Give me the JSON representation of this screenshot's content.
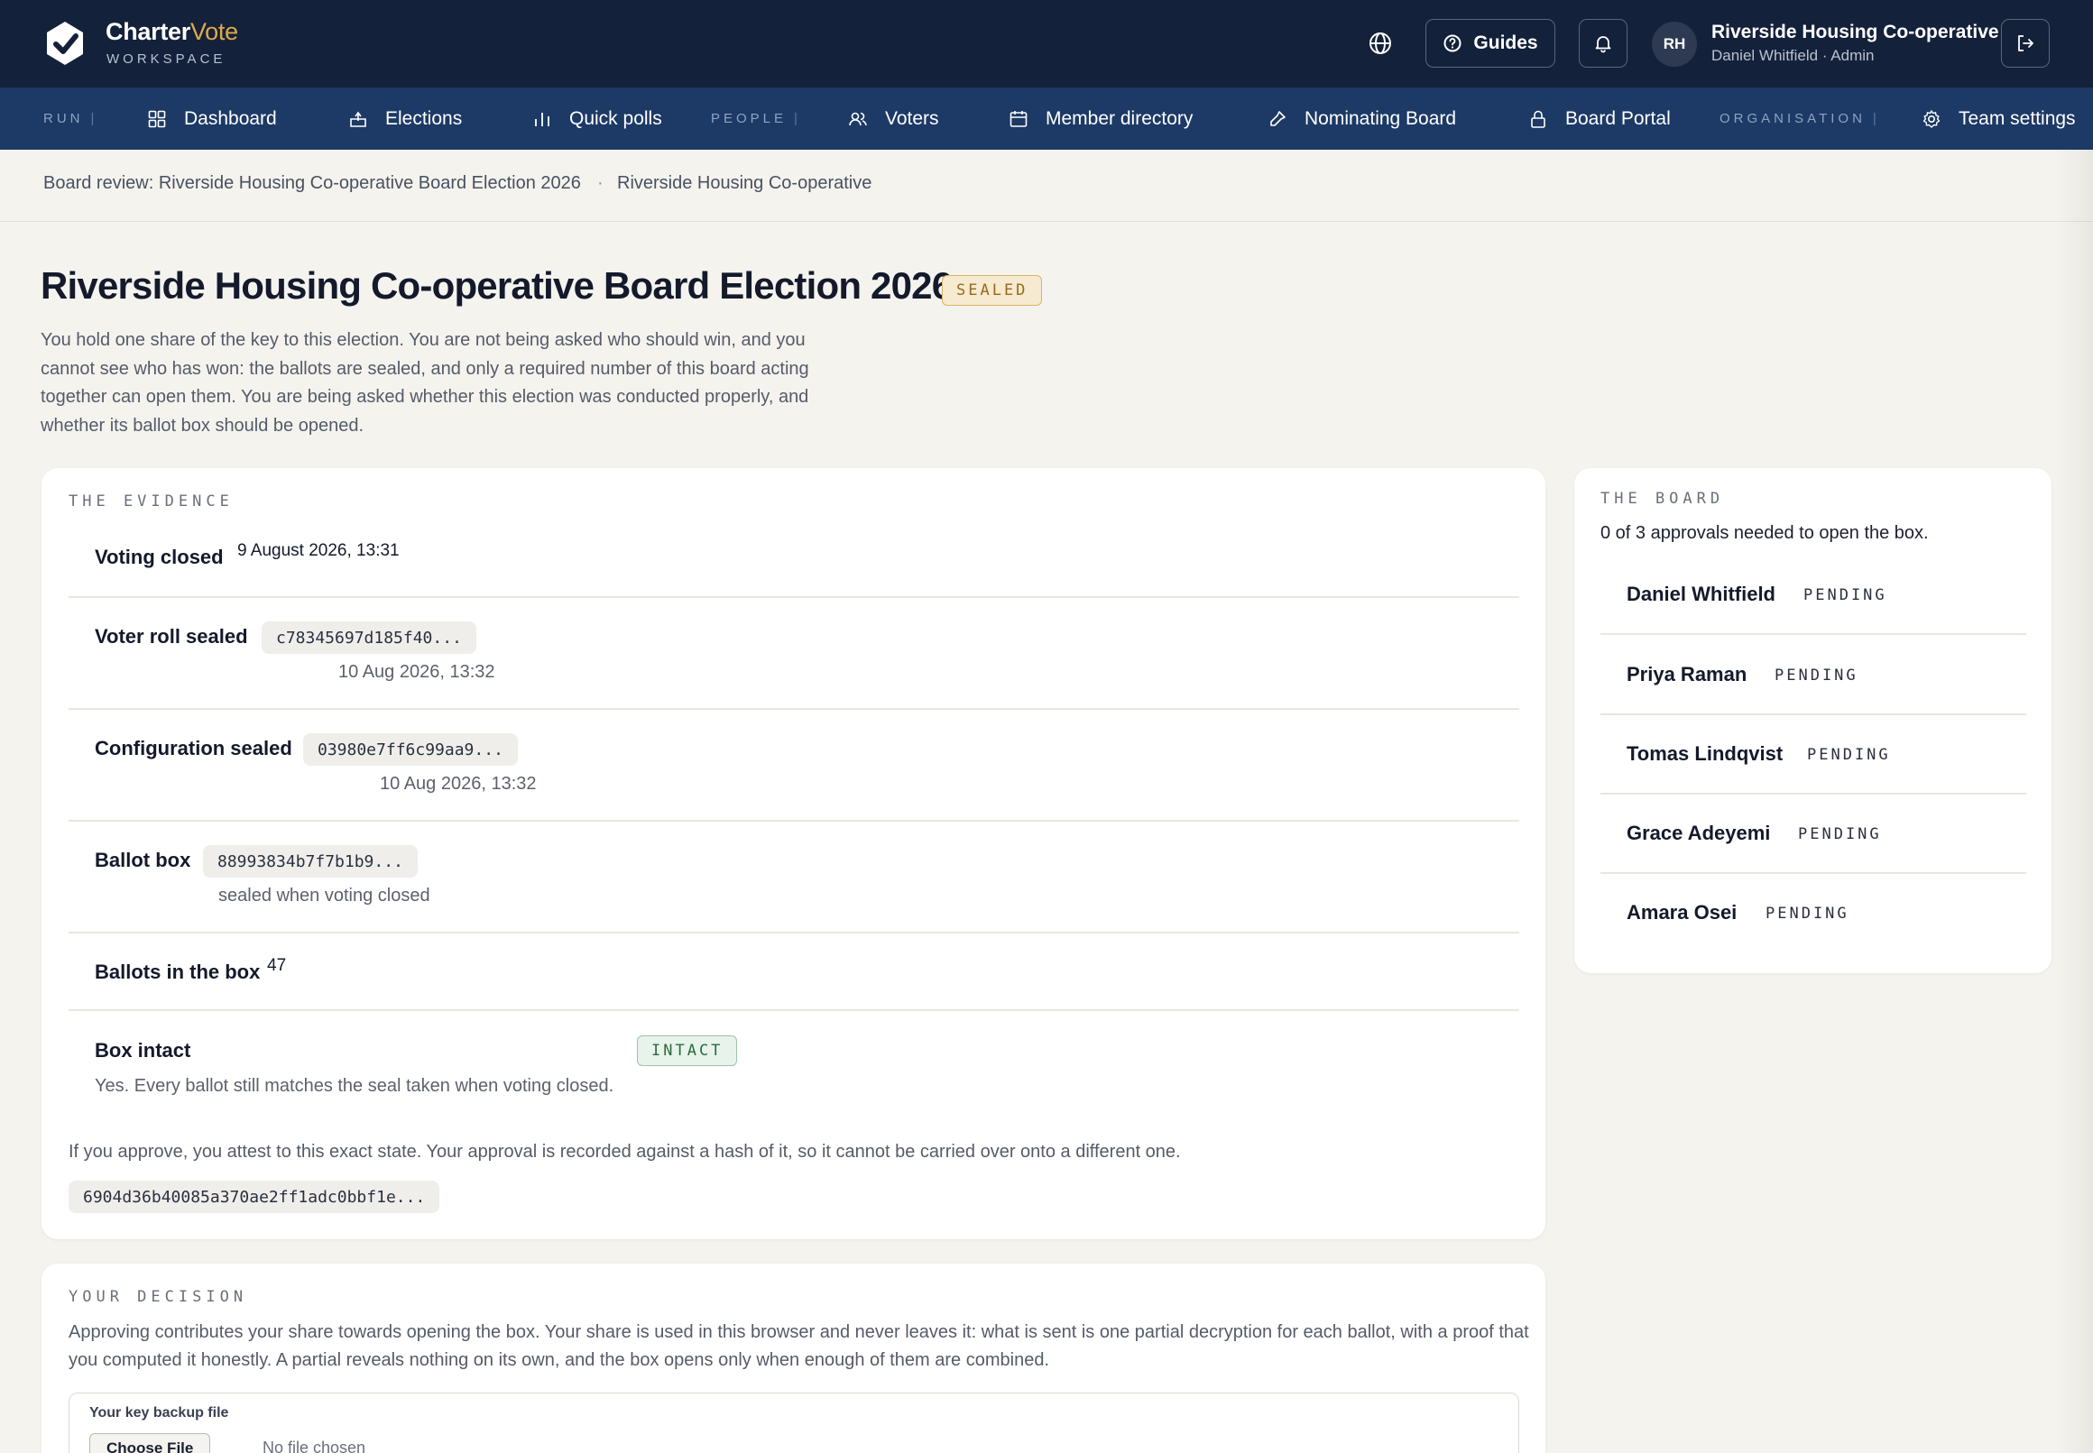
{
  "brand": {
    "name_part1": "Charter",
    "name_part2": "Vote",
    "subtitle": "WORKSPACE"
  },
  "header": {
    "guides_label": "Guides",
    "avatar_initials": "RH",
    "org_name": "Riverside Housing Co-operative",
    "user_line": "Daniel Whitfield · Admin"
  },
  "nav": {
    "groups": {
      "run": "RUN",
      "people": "PEOPLE",
      "organisation": "ORGANISATION"
    },
    "items": {
      "dashboard": "Dashboard",
      "elections": "Elections",
      "quick_polls": "Quick polls",
      "voters": "Voters",
      "member_directory": "Member directory",
      "nominating_board": "Nominating Board",
      "board_portal": "Board Portal",
      "team_settings": "Team settings"
    }
  },
  "breadcrumb": {
    "page": "Board review: Riverside Housing Co-operative Board Election 2026",
    "org": "Riverside Housing Co-operative"
  },
  "page": {
    "title": "Riverside Housing Co-operative Board Election 2026",
    "status_badge": "SEALED",
    "intro": "You hold one share of the key to this election. You are not being asked who should win, and you cannot see who has won: the ballots are sealed, and only a required number of this board acting together can open them. You are being asked whether this election was conducted properly, and whether its ballot box should be opened."
  },
  "evidence": {
    "heading": "THE EVIDENCE",
    "voting_closed": {
      "label": "Voting closed",
      "value": "9 August 2026, 13:31"
    },
    "voter_roll": {
      "label": "Voter roll sealed",
      "hash": "c78345697d185f40...",
      "time": "10 Aug 2026, 13:32"
    },
    "configuration": {
      "label": "Configuration sealed",
      "hash": "03980e7ff6c99aa9...",
      "time": "10 Aug 2026, 13:32"
    },
    "ballot_box": {
      "label": "Ballot box",
      "hash": "88993834b7f7b1b9...",
      "note": "sealed when voting closed"
    },
    "ballots": {
      "label": "Ballots in the box",
      "value": "47"
    },
    "box_intact": {
      "label": "Box intact",
      "badge": "INTACT",
      "note": "Yes. Every ballot still matches the seal taken when voting closed."
    },
    "attest_text": "If you approve, you attest to this exact state. Your approval is recorded against a hash of it, so it cannot be carried over onto a different one.",
    "attest_hash": "6904d36b40085a370ae2ff1adc0bbf1e..."
  },
  "board": {
    "heading": "THE BOARD",
    "note": "0 of 3 approvals needed to open the box.",
    "members": [
      {
        "name": "Daniel Whitfield",
        "status": "PENDING"
      },
      {
        "name": "Priya Raman",
        "status": "PENDING"
      },
      {
        "name": "Tomas Lindqvist",
        "status": "PENDING"
      },
      {
        "name": "Grace Adeyemi",
        "status": "PENDING"
      },
      {
        "name": "Amara Osei",
        "status": "PENDING"
      }
    ]
  },
  "decision": {
    "heading": "YOUR DECISION",
    "text": "Approving contributes your share towards opening the box. Your share is used in this browser and never leaves it: what is sent is one partial decryption for each ballot, with a proof that you computed it honestly. A partial reveals nothing on its own, and the box opens only when enough of them are combined.",
    "file_label": "Your key backup file",
    "choose_button": "Choose File",
    "no_file": "No file chosen"
  },
  "colors": {
    "topbar": "#13213a",
    "navbar": "#1d3a66",
    "accent": "#e0a84a",
    "background": "#f4f3ee",
    "sealed_badge": "#f6ead0",
    "intact_badge": "#e8f3eb"
  },
  "icons": [
    "logo-mark-icon",
    "globe-icon",
    "help-circle-icon",
    "bell-icon",
    "logout-icon",
    "dashboard-icon",
    "elections-icon",
    "quick-polls-icon",
    "voters-icon",
    "member-directory-icon",
    "nominating-board-icon",
    "board-portal-icon",
    "team-settings-icon"
  ]
}
